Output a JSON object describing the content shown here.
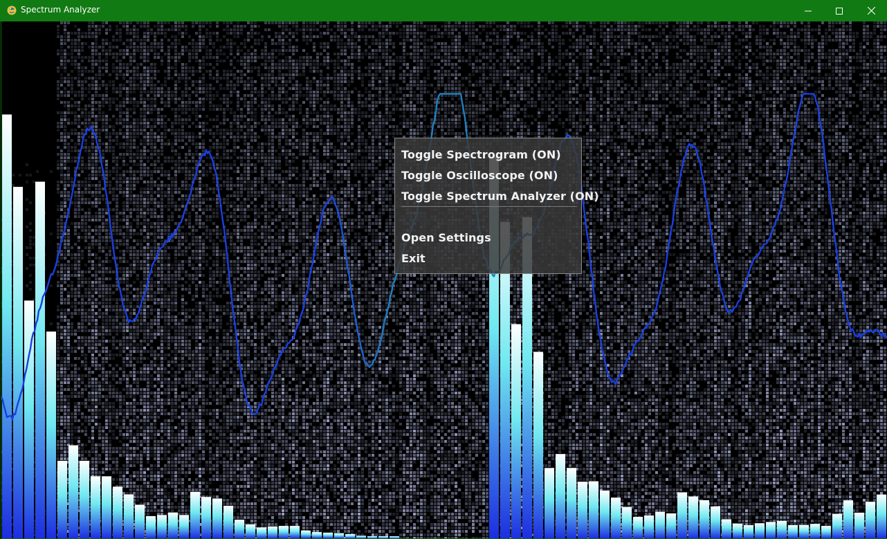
{
  "window": {
    "title": "Spectrum Analyzer",
    "icon": "python-snake-icon",
    "controls": [
      "minimize-icon",
      "maximize-icon",
      "close-icon"
    ],
    "frame_color": "#117a13"
  },
  "menu": {
    "items": [
      {
        "label": "Toggle Spectrogram (ON)"
      },
      {
        "label": "Toggle Oscilloscope (ON)"
      },
      {
        "label": "Toggle Spectrum Analyzer (ON)"
      },
      {
        "label": "Open Settings"
      },
      {
        "label": "Exit"
      }
    ]
  },
  "visualizer": {
    "spectrogram_enabled": true,
    "oscilloscope_enabled": true,
    "spectrum_analyzer_enabled": true,
    "colors": {
      "background": "#000000",
      "oscilloscope_line": "#1a3fe0",
      "oscilloscope_line_under_menu": "#1f7fc0",
      "bar_top": "#ffffff",
      "bar_mid": "#6fe8f0",
      "bar_bottom": "#1c2ee0",
      "spectrogram_cell": "#c8d0ff"
    },
    "spectrum_levels": [
      0.82,
      0.68,
      0.46,
      0.69,
      0.4,
      0.15,
      0.18,
      0.15,
      0.12,
      0.12,
      0.1,
      0.085,
      0.065,
      0.043,
      0.045,
      0.05,
      0.045,
      0.09,
      0.08,
      0.077,
      0.063,
      0.036,
      0.027,
      0.021,
      0.023,
      0.024,
      0.024,
      0.015,
      0.012,
      0.011,
      0.01,
      0.008,
      0.005,
      0.004,
      0.003,
      0.003
    ]
  }
}
